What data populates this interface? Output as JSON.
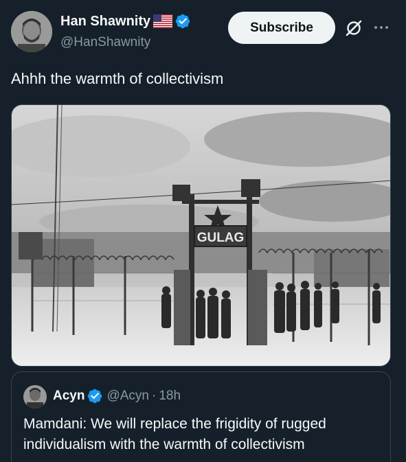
{
  "author": {
    "display_name": "Han Shawnity",
    "handle": "@HanShawnity",
    "flag_icon": "us-flag-icon",
    "verified_icon": "verified-badge-icon",
    "verified_color": "#1d9bf0"
  },
  "header": {
    "subscribe_label": "Subscribe",
    "grok_icon": "grok-icon",
    "more_icon": "more-options-icon"
  },
  "tweet": {
    "text": "Ahhh the warmth of collectivism",
    "media": {
      "description_icon": "photo",
      "sign_text": "GULAG"
    }
  },
  "quote": {
    "display_name": "Acyn",
    "handle": "@Acyn",
    "separator": "·",
    "time": "18h",
    "text": "Mamdani: We will replace the frigidity of rugged individualism with the warmth of collectivism"
  },
  "colors": {
    "background": "#15202b",
    "text_primary": "#f7f9f9",
    "text_secondary": "#8b98a5",
    "border": "#38444d",
    "subscribe_bg": "#eff3f4",
    "accent": "#1d9bf0"
  }
}
